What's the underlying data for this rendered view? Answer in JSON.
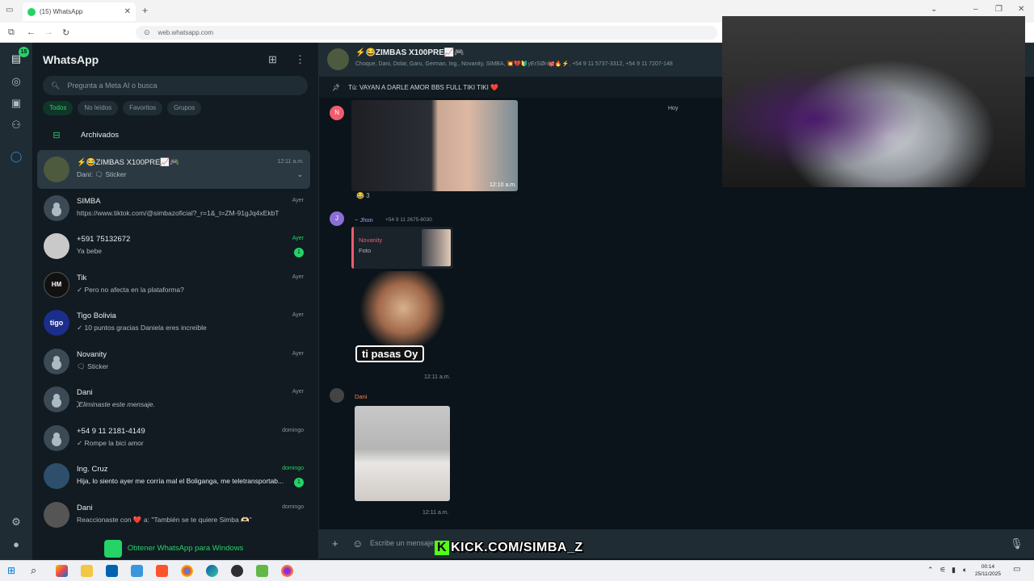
{
  "browser": {
    "tab_title": "(15) WhatsApp",
    "new_tab": "+",
    "url": "web.whatsapp.com"
  },
  "rail": {
    "chats_badge": "15"
  },
  "sidebar": {
    "title": "WhatsApp",
    "search_placeholder": "Pregunta a Meta AI o busca",
    "filters": [
      "Todos",
      "No leídos",
      "Favoritos",
      "Grupos"
    ],
    "archived_label": "Archivados",
    "get_app_label": "Obtener WhatsApp para Windows",
    "chats": [
      {
        "name": "⚡😂ZIMBAS X100PRE📈🎮",
        "message": "Dani: 🗨 Sticker",
        "time": "12:11 a.m.",
        "unread": "",
        "time_green": false,
        "avatar": "group"
      },
      {
        "name": "SIMBA",
        "message": "https://www.tiktok.com/@simbazoficial?_r=1&_t=ZM-91gJq4xEkbT",
        "time": "Ayer",
        "unread": "",
        "time_green": false,
        "avatar": "generic"
      },
      {
        "name": "+591 75132672",
        "message": "Ya bebe",
        "time": "Ayer",
        "unread": "1",
        "time_green": true,
        "avatar": "photo"
      },
      {
        "name": "Tik",
        "message": "✓ Pero no afecta en la plataforma?",
        "time": "Ayer",
        "unread": "",
        "time_green": false,
        "avatar": "hm"
      },
      {
        "name": "Tigo Bolivia",
        "message": "✓ 10 puntos gracias Daniela eres increible",
        "time": "Ayer",
        "unread": "",
        "time_green": false,
        "avatar": "tigo"
      },
      {
        "name": "Novanity",
        "message": "🗨 Sticker",
        "time": "Ayer",
        "unread": "",
        "time_green": false,
        "avatar": "generic"
      },
      {
        "name": "Dani",
        "message": "⃠ Eliminaste este mensaje.",
        "time": "Ayer",
        "unread": "",
        "time_green": false,
        "avatar": "generic"
      },
      {
        "name": "+54 9 11 2181-4149",
        "message": "✓ Rompe la bici amor",
        "time": "domingo",
        "unread": "",
        "time_green": false,
        "avatar": "generic"
      },
      {
        "name": "Ing. Cruz",
        "message": "Hija, lo siento ayer me corría mal el Boliganga, me teletransportab...",
        "time": "domingo",
        "unread": "1",
        "time_green": true,
        "avatar": "photo2"
      },
      {
        "name": "Dani",
        "message": "Reaccionaste con ❤️ a: \"También se te quiere Simba 🫶🏻\"",
        "time": "domingo",
        "unread": "",
        "time_green": false,
        "avatar": "photo3"
      }
    ]
  },
  "conversation": {
    "title": "⚡😂ZIMBAS X100PRE📈🎮",
    "members": "Choque, Dani, Dolar, Garu, German, Ing., Novanity, SIMBA, 💥💔🔰yErSØn🐙🔥⚡, +54 9 11 5737-3312, +54 9 11 7207-148",
    "pinned": "Tú: VAYAN A DARLE AMOR BBS FULL TIKI TIKI ❤️",
    "date_label": "Hoy",
    "messages": [
      {
        "sender_initial": "N",
        "time": "12:10 a.m.",
        "reaction": "😂 3"
      },
      {
        "sender_initial": "J",
        "sender": "~ Jhon",
        "phone": "+54 9 11 2675-6030",
        "quote_name": "Novanity",
        "quote_type": "Foto",
        "sticker_text": "ti pasas Oy",
        "time": "12:11 a.m."
      },
      {
        "sender": "Dani",
        "time": "12:11 a.m."
      }
    ],
    "composer_placeholder": "Escribe un mensaje"
  },
  "overlay": {
    "kick_text": "KICK.COM/SIMBA_Z",
    "kick_logo": "K"
  },
  "taskbar": {
    "time": "00:14",
    "date": "25/11/2025"
  },
  "colors": {
    "accent": "#25d366",
    "panel": "#111b21",
    "header": "#202c33",
    "background": "#0b141a"
  }
}
